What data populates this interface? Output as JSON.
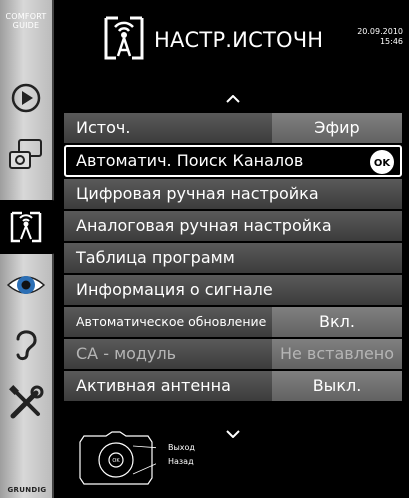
{
  "sidebar": {
    "comfort_guide_line1": "COMFORT",
    "comfort_guide_line2": "GUIDE",
    "items": [
      {
        "icon": "play-icon"
      },
      {
        "icon": "picture-settings-icon"
      },
      {
        "icon": "source-settings-icon",
        "selected": true
      },
      {
        "icon": "eye-icon"
      },
      {
        "icon": "ear-icon"
      },
      {
        "icon": "tools-icon"
      }
    ],
    "brand": "GRUNDIG"
  },
  "header": {
    "title": "НАСТР.ИСТОЧН",
    "date": "20.09.2010",
    "time": "15:46",
    "icon": "antenna-source-icon"
  },
  "menu": {
    "rows": [
      {
        "label": "Источ.",
        "value": "Эфир"
      },
      {
        "label": "Автоматич. Поиск Каналов",
        "ok": "OK",
        "selected": true
      },
      {
        "label": "Цифровая ручная настройка"
      },
      {
        "label": "Аналоговая ручная настройка"
      },
      {
        "label": "Таблица программ"
      },
      {
        "label": "Информация о сигнале"
      },
      {
        "label": "Автоматическое обновление",
        "value": "Вкл."
      },
      {
        "label": "CA - модуль",
        "value": "Не вставлено",
        "disabled": true
      },
      {
        "label": "Активная антенна",
        "value": "Выкл."
      }
    ]
  },
  "legend": {
    "ok_label": "OK",
    "exit": "Выход",
    "back": "Назад"
  },
  "colors": {
    "background": "#000000",
    "row": "#4a4a4a",
    "value_cell": "#707070",
    "sidebar": "#c8c8c8"
  }
}
